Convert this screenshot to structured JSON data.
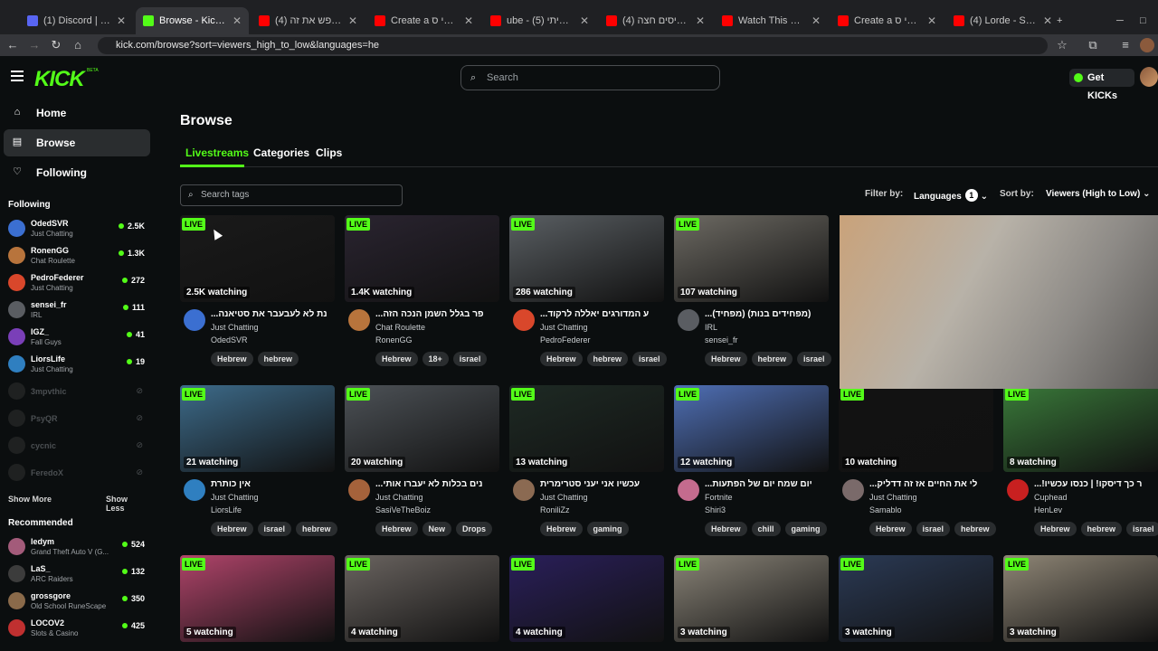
{
  "browser": {
    "tabs": [
      {
        "title": "(1) Discord | #להוביכ",
        "color": "#5865f2",
        "active": false
      },
      {
        "title": "Browse - Kick Stream",
        "color": "#53fc18",
        "active": true
      },
      {
        "title": "(4) רגון מחפש את זה",
        "color": "#ff0000",
        "active": false
      },
      {
        "title": "Create a א סטמי ס",
        "color": "#ff0000",
        "active": false
      },
      {
        "title": "ube - ממקום אמיתי (5)",
        "color": "#ff0000",
        "active": false
      },
      {
        "title": "(4) איתן ניסים חצה",
        "color": "#ff0000",
        "active": false
      },
      {
        "title": "Watch This Stream Tc",
        "color": "#ff0000",
        "active": false
      },
      {
        "title": "Create a א סטמי ס",
        "color": "#ff0000",
        "active": false
      },
      {
        "title": "(4) Lorde - Supercut",
        "color": "#ff0000",
        "active": false
      }
    ],
    "url": "kick.com/browse?sort=viewers_high_to_low&languages=he"
  },
  "topbar": {
    "logo": "KICK",
    "logo_badge": "BETA",
    "search_placeholder": "Search",
    "get_kicks": "Get KICKs"
  },
  "sidebar": {
    "nav": [
      {
        "label": "Home",
        "icon": "home-icon",
        "active": false
      },
      {
        "label": "Browse",
        "icon": "browse-icon",
        "active": true
      },
      {
        "label": "Following",
        "icon": "heart-icon",
        "active": false
      }
    ],
    "following_header": "Following",
    "following": [
      {
        "name": "OdedSVR",
        "category": "Just Chatting",
        "count": "2.5K",
        "color": "#3b6fd1",
        "live": true
      },
      {
        "name": "RonenGG",
        "category": "Chat Roulette",
        "count": "1.3K",
        "color": "#b8743c",
        "live": true
      },
      {
        "name": "PedroFederer",
        "category": "Just Chatting",
        "count": "272",
        "color": "#d9472b",
        "live": true
      },
      {
        "name": "sensei_fr",
        "category": "IRL",
        "count": "111",
        "color": "#5a5d62",
        "live": true
      },
      {
        "name": "IGZ_",
        "category": "Fall Guys",
        "count": "41",
        "color": "#7a3fb8",
        "live": true
      },
      {
        "name": "LiorsLife",
        "category": "Just Chatting",
        "count": "19",
        "color": "#2f7fc0",
        "live": true
      },
      {
        "name": "3mpvthic",
        "category": "",
        "count": "",
        "color": "#444",
        "live": false
      },
      {
        "name": "PsyQR",
        "category": "",
        "count": "",
        "color": "#444",
        "live": false
      },
      {
        "name": "cycnic",
        "category": "",
        "count": "",
        "color": "#444",
        "live": false
      },
      {
        "name": "FeredoX",
        "category": "",
        "count": "",
        "color": "#444",
        "live": false
      }
    ],
    "show_more": "Show More",
    "show_less": "Show Less",
    "recommended_header": "Recommended",
    "recommended": [
      {
        "name": "ledym",
        "category": "Grand Theft Auto V (G...",
        "count": "524",
        "color": "#a35b7a"
      },
      {
        "name": "LaS_",
        "category": "ARC Raiders",
        "count": "132",
        "color": "#3c3c3c"
      },
      {
        "name": "grossgore",
        "category": "Old School RuneScape",
        "count": "350",
        "color": "#8a6a4a"
      },
      {
        "name": "LOCOV2",
        "category": "Slots & Casino",
        "count": "425",
        "color": "#c03030"
      }
    ]
  },
  "main": {
    "title": "Browse",
    "tabs": [
      "Livestreams",
      "Categories",
      "Clips"
    ],
    "tag_search_placeholder": "Search tags",
    "filter_label": "Filter by:",
    "filter_value": "Languages",
    "filter_count": "1",
    "sort_label": "Sort by:",
    "sort_value": "Viewers (High to Low)",
    "live_label": "LIVE",
    "streams": [
      {
        "watching": "2.5K watching",
        "title": "נת לא לעבעבר את סטיאנה...",
        "category": "Just Chatting",
        "streamer": "OdedSVR",
        "tags": [
          "Hebrew",
          "hebrew"
        ],
        "thumb": "#1a1a1a",
        "avatar": "#3b6fd1"
      },
      {
        "watching": "1.4K watching",
        "title": "פר בגלל השמן הנכה הזה...",
        "category": "Chat Roulette",
        "streamer": "RonenGG",
        "tags": [
          "Hebrew",
          "18+",
          "israel"
        ],
        "thumb": "#2a2430",
        "avatar": "#b8743c"
      },
      {
        "watching": "286 watching",
        "title": "ע המדורגים יאללה לרקוד...",
        "category": "Just Chatting",
        "streamer": "PedroFederer",
        "tags": [
          "Hebrew",
          "hebrew",
          "israel"
        ],
        "thumb": "#5a5f63",
        "avatar": "#d9472b"
      },
      {
        "watching": "107 watching",
        "title": "(מפחידים בנות) (מפחיד)...",
        "category": "IRL",
        "streamer": "sensei_fr",
        "tags": [
          "Hebrew",
          "hebrew",
          "israel"
        ],
        "thumb": "#6d6a63",
        "avatar": "#5a5d62"
      },
      {
        "watching": "21 watching",
        "title": "אין כותרת",
        "category": "Just Chatting",
        "streamer": "LiorsLife",
        "tags": [
          "Hebrew",
          "israel",
          "hebrew"
        ],
        "thumb": "#3d6b8a",
        "avatar": "#2f7fc0"
      },
      {
        "watching": "20 watching",
        "title": "נים בכלות לא יעברו אותי...",
        "category": "Just Chatting",
        "streamer": "SasiVeTheBoiz",
        "tags": [
          "Hebrew",
          "New",
          "Drops"
        ],
        "thumb": "#4d5257",
        "avatar": "#a5623b"
      },
      {
        "watching": "13 watching",
        "title": "עכשיו אני יעני סטרימרית",
        "category": "Just Chatting",
        "streamer": "RoniliZz",
        "tags": [
          "Hebrew",
          "gaming"
        ],
        "thumb": "#1e2a24",
        "avatar": "#8b6a52"
      },
      {
        "watching": "12 watching",
        "title": "יום שמח יום של הפתעות...",
        "category": "Fortnite",
        "streamer": "Shiri3",
        "tags": [
          "Hebrew",
          "chill",
          "gaming"
        ],
        "thumb": "#4f6fb5",
        "avatar": "#c46b8e"
      },
      {
        "watching": "10 watching",
        "title": "לי את החיים אז זה דדליק...",
        "category": "Just Chatting",
        "streamer": "Samablo",
        "tags": [
          "Hebrew",
          "israel",
          "hebrew"
        ],
        "thumb": "#121212",
        "avatar": "#7a6a6a"
      },
      {
        "watching": "8 watching",
        "title": "ר כך דיסקו! | כנסו עכשיו!...",
        "category": "Cuphead",
        "streamer": "HenLev",
        "tags": [
          "Hebrew",
          "hebrew",
          "israel"
        ],
        "thumb": "#3a7a3a",
        "avatar": "#c82020"
      },
      {
        "watching": "5 watching",
        "title": "",
        "category": "",
        "streamer": "",
        "tags": [],
        "thumb": "#b0446a",
        "avatar": "#000"
      },
      {
        "watching": "4 watching",
        "title": "",
        "category": "",
        "streamer": "",
        "tags": [],
        "thumb": "#6a6460",
        "avatar": "#000"
      },
      {
        "watching": "4 watching",
        "title": "",
        "category": "",
        "streamer": "",
        "tags": [],
        "thumb": "#2a1f5a",
        "avatar": "#000"
      },
      {
        "watching": "3 watching",
        "title": "",
        "category": "",
        "streamer": "",
        "tags": [],
        "thumb": "#8a8478",
        "avatar": "#000"
      },
      {
        "watching": "3 watching",
        "title": "",
        "category": "",
        "streamer": "",
        "tags": [],
        "thumb": "#2b3a55",
        "avatar": "#000"
      },
      {
        "watching": "3 watching",
        "title": "",
        "category": "",
        "streamer": "",
        "tags": [],
        "thumb": "#8f8676",
        "avatar": "#000"
      }
    ]
  },
  "colors": {
    "accent": "#53fc18",
    "bg": "#0b0e0f",
    "panel": "#2a2d2f"
  }
}
